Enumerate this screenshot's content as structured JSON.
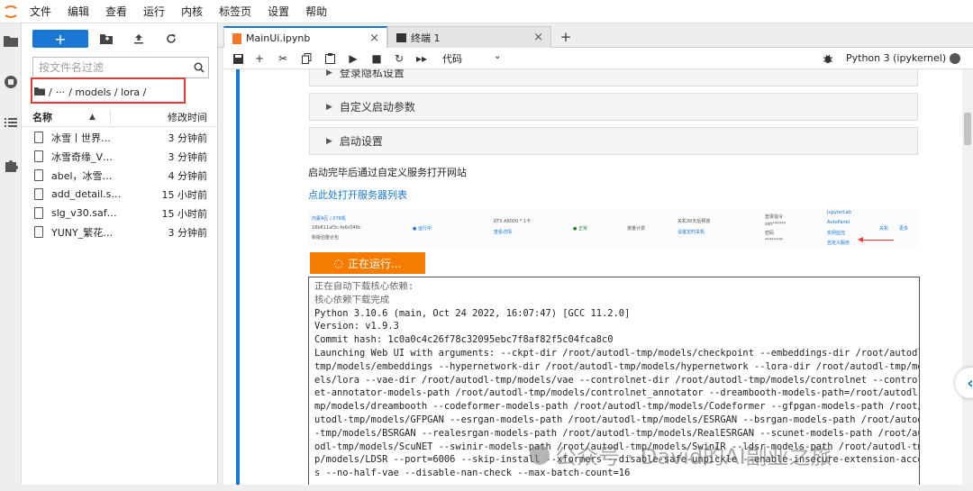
{
  "menu": [
    "文件",
    "编辑",
    "查看",
    "运行",
    "内核",
    "标签页",
    "设置",
    "帮助"
  ],
  "filebrowser": {
    "new_label": "+",
    "filter_placeholder": "按文件名过滤",
    "breadcrumb": [
      "/",
      "···",
      "/ models / lora /"
    ],
    "col_name": "名称",
    "col_modified": "修改时间",
    "files": [
      {
        "name": "冰雪丨世界…",
        "time": "3 分钟前"
      },
      {
        "name": "冰雪奇缘_V…",
        "time": "3 分钟前"
      },
      {
        "name": "abel，冰雪…",
        "time": "4 分钟前"
      },
      {
        "name": "add_detail.s…",
        "time": "15 小时前"
      },
      {
        "name": "slg_v30.saf…",
        "time": "15 小时前"
      },
      {
        "name": "YUNY_繁花…",
        "time": "3 分钟前"
      }
    ]
  },
  "tabs": [
    {
      "label": "MainUi.ipynb",
      "close": "×"
    },
    {
      "label": "终端 1",
      "close": "×"
    }
  ],
  "add_tab": "+",
  "notebook_toolbar": {
    "cell_type": "代码",
    "kernel": "Python 3 (ipykernel)"
  },
  "accordions": [
    "登录隐私设置",
    "自定义启动参数",
    "启动设置"
  ],
  "info_text": "启动完毕后通过自定义服务打开网站",
  "server_link": "点此处打开服务器列表",
  "server_panel": {
    "region": "内蒙A区 / 078机",
    "instance_id": "18b611af3c-fe6c048c",
    "remark": "新版伯整合包",
    "status": "● 运行中",
    "gpu": "RTX A6000 * 1卡",
    "view_detail": "查看详情",
    "health": "● 正常",
    "billing": "按量计费",
    "shutdown": "关机30天后释放",
    "set_shutdown": "设置定时关机",
    "login_cmd": "登录指令",
    "ssh": "ssh******",
    "password": "密码",
    "pwd_mask": "********",
    "links": [
      "JupyterLab",
      "AutoPanel",
      "实例监控",
      "自定义服务"
    ],
    "power": "关机",
    "more": "更多"
  },
  "run_button": "正在运行...",
  "log_lines": [
    {
      "text": "正在自动下载核心依赖:",
      "muted": true
    },
    {
      "text": "核心依赖下载完成",
      "muted": true
    },
    {
      "text": "Python 3.10.6 (main, Oct 24 2022, 16:07:47) [GCC 11.2.0]",
      "muted": false
    },
    {
      "text": "Version: v1.9.3",
      "muted": false
    },
    {
      "text": "Commit hash: 1c0a0c4c26f78c32095ebc7f8af82f5c04fca8c0",
      "muted": false
    },
    {
      "text": "Launching Web UI with arguments: --ckpt-dir /root/autodl-tmp/models/checkpoint --embeddings-dir /root/autodl-",
      "muted": false
    },
    {
      "text": "tmp/models/embeddings --hypernetwork-dir /root/autodl-tmp/models/hypernetwork --lora-dir /root/autodl-tmp/mod",
      "muted": false
    },
    {
      "text": "els/lora --vae-dir /root/autodl-tmp/models/vae --controlnet-dir /root/autodl-tmp/models/controlnet --controln",
      "muted": false
    },
    {
      "text": "et-annotator-models-path /root/autodl-tmp/models/controlnet_annotator --dreambooth-models-path=/root/autodl-t",
      "muted": false
    },
    {
      "text": "mp/models/dreambooth --codeformer-models-path /root/autodl-tmp/models/Codeformer --gfpgan-models-path /root/a",
      "muted": false
    },
    {
      "text": "utodl-tmp/models/GFPGAN --esrgan-models-path /root/autodl-tmp/models/ESRGAN --bsrgan-models-path /root/autodl",
      "muted": false
    },
    {
      "text": "-tmp/models/BSRGAN --realesrgan-models-path /root/autodl-tmp/models/RealESRGAN --scunet-models-path /root/aut",
      "muted": false
    },
    {
      "text": "odl-tmp/models/ScuNET --swinir-models-path /root/autodl-tmp/models/SwinIR --ldsr-models-path /root/autodl-tm",
      "muted": false
    },
    {
      "text": "p/models/LDSR --port=6006 --skip-install --xformers --disable-safe-unpickle --enable-insecure-extension-acces",
      "muted": false
    },
    {
      "text": "s --no-half-vae --disable-nan-check --max-batch-count=16",
      "muted": false
    }
  ],
  "watermark": "公众号 · David的AI副业之旅"
}
